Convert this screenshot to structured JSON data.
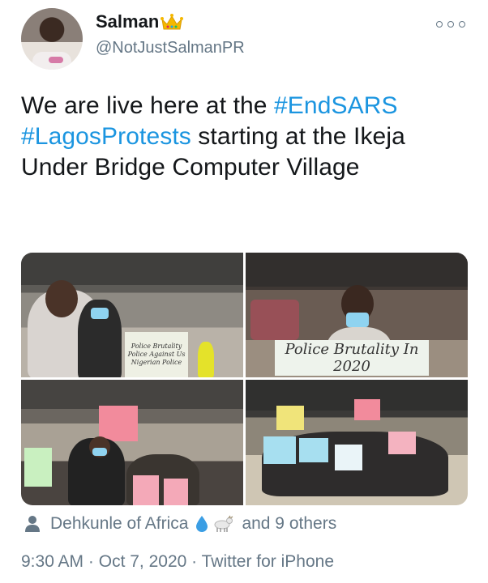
{
  "author": {
    "display_name": "Salman",
    "badge_icon": "crown-icon",
    "handle": "@NotJustSalmanPR"
  },
  "tweet": {
    "text_part1": "We are live here at the ",
    "hashtag1": "#EndSARS",
    "hashtag2": "#LagosProtests",
    "text_part2": " starting at the Ikeja Under Bridge Computer Village"
  },
  "media": {
    "photo1": {
      "sign_text": "Police Brutality Police Against Us Nigerian Police"
    },
    "photo2": {
      "sign_text": "Police Brutality In 2020"
    },
    "photo3": {
      "sign_text": ""
    },
    "photo4": {
      "sign_text": ""
    }
  },
  "liked_by": {
    "name": "Dehkunle of Africa",
    "emoji_icons": [
      "droplet-icon",
      "goat-icon"
    ],
    "others_text": "and 9 others"
  },
  "meta": {
    "time": "9:30 AM",
    "date": "Oct 7, 2020",
    "source": "Twitter for iPhone",
    "separator": " · "
  },
  "colors": {
    "link": "#1b95e0",
    "secondary": "#657786",
    "primary_text": "#14171a"
  }
}
